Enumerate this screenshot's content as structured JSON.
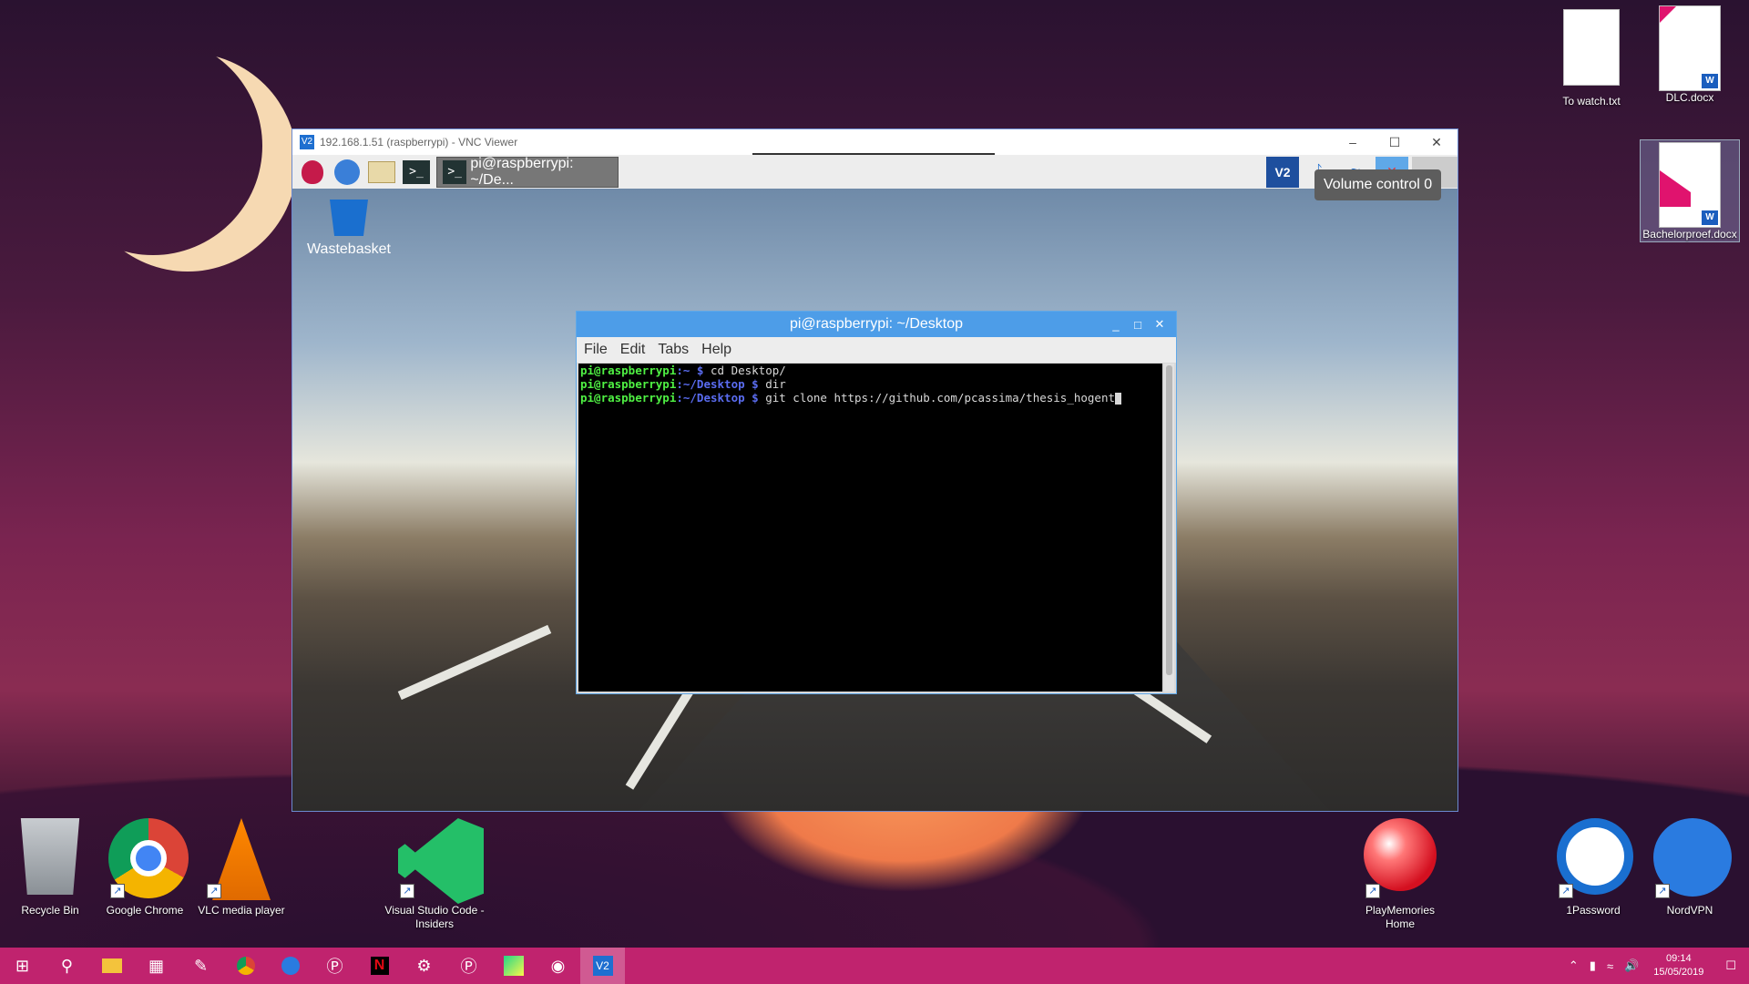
{
  "desktop": {
    "top_icons": [
      {
        "label": "To watch.txt"
      },
      {
        "label": "DLC.docx"
      },
      {
        "label": "Bachelorproef.docx"
      }
    ],
    "bottom_icons": [
      {
        "label": "Recycle Bin"
      },
      {
        "label": "Google Chrome"
      },
      {
        "label": "VLC media player"
      },
      {
        "label": "Visual Studio Code - Insiders"
      },
      {
        "label": "PlayMemories Home"
      },
      {
        "label": "1Password"
      },
      {
        "label": "NordVPN"
      }
    ]
  },
  "vnc": {
    "title": "192.168.1.51 (raspberrypi) - VNC Viewer",
    "icon_text": "V2",
    "task_label": "pi@raspberrypi: ~/De...",
    "tooltip": "Volume control 0",
    "wastebasket_label": "Wastebasket"
  },
  "terminal": {
    "title": "pi@raspberrypi: ~/Desktop",
    "menu": [
      "File",
      "Edit",
      "Tabs",
      "Help"
    ],
    "lines": [
      {
        "user": "pi@raspberrypi",
        "path": ":~ $",
        "cmd": " cd Desktop/"
      },
      {
        "user": "pi@raspberrypi",
        "path": ":~/Desktop $",
        "cmd": " dir"
      },
      {
        "user": "pi@raspberrypi",
        "path": ":~/Desktop $",
        "cmd": " git clone https://github.com/pcassima/thesis_hogent"
      }
    ]
  },
  "taskbar": {
    "clock_time": "09:14",
    "clock_date": "15/05/2019"
  },
  "colors": {
    "taskbar": "#c0236e",
    "terminal_title": "#4d9de8",
    "prompt_user": "#4ff043",
    "prompt_path": "#5a6cf0"
  }
}
